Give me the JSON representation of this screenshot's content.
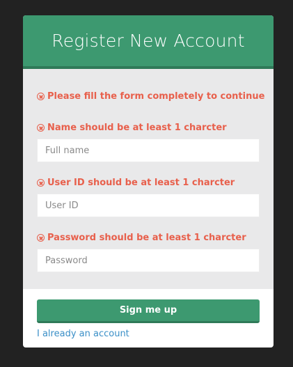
{
  "form": {
    "title": "Register New Account",
    "general_error": "Please fill the form completely to continue",
    "fields": [
      {
        "error": "Name should be at least 1 charcter",
        "placeholder": "Full name",
        "value": ""
      },
      {
        "error": "User ID should be at least 1 charcter",
        "placeholder": "User ID",
        "value": ""
      },
      {
        "error": "Password should be at least 1 charcter",
        "placeholder": "Password",
        "value": ""
      }
    ],
    "submit_label": "Sign me up",
    "login_link": "I already an account"
  },
  "colors": {
    "accent": "#3d9970",
    "error": "#e8604c",
    "link": "#3a8fc7",
    "background": "#222222"
  },
  "icons": {
    "error": "circle-x-icon"
  }
}
